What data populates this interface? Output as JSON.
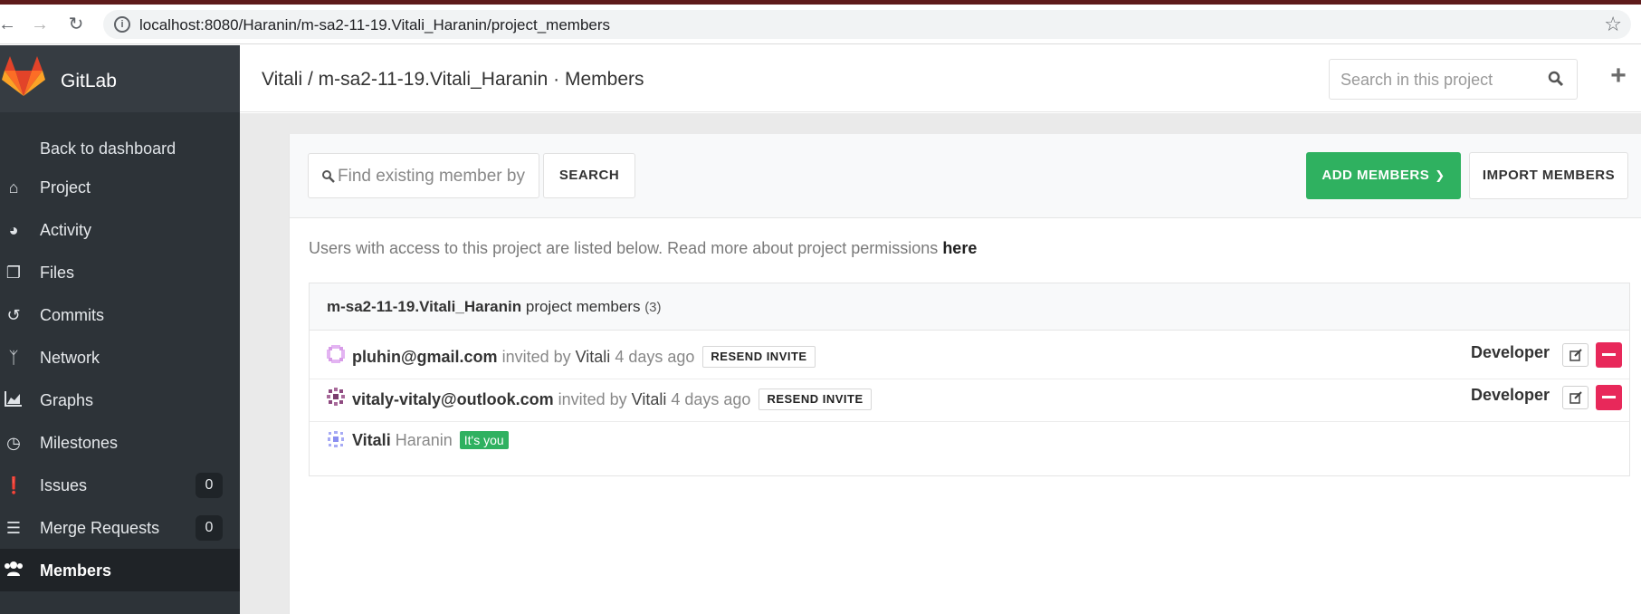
{
  "browser": {
    "url": "localhost:8080/Haranin/m-sa2-11-19.Vitali_Haranin/project_members"
  },
  "sidebar": {
    "brand": "GitLab",
    "back_label": "Back to dashboard",
    "items": [
      {
        "label": "Project",
        "icon": "home-icon"
      },
      {
        "label": "Activity",
        "icon": "dashboard-icon"
      },
      {
        "label": "Files",
        "icon": "files-icon"
      },
      {
        "label": "Commits",
        "icon": "history-icon"
      },
      {
        "label": "Network",
        "icon": "code-fork-icon"
      },
      {
        "label": "Graphs",
        "icon": "area-chart-icon"
      },
      {
        "label": "Milestones",
        "icon": "clock-icon"
      },
      {
        "label": "Issues",
        "icon": "exclamation-circle-icon",
        "badge": "0"
      },
      {
        "label": "Merge Requests",
        "icon": "tasks-icon",
        "badge": "0"
      },
      {
        "label": "Members",
        "icon": "users-icon",
        "active": true
      }
    ]
  },
  "header": {
    "title": "Vitali / m-sa2-11-19.Vitali_Haranin · Members",
    "search_placeholder": "Search in this project"
  },
  "toolbar": {
    "find_placeholder": "Find existing member by",
    "search_label": "SEARCH",
    "add_label": "ADD MEMBERS",
    "import_label": "IMPORT MEMBERS"
  },
  "info": {
    "text": "Users with access to this project are listed below. Read more about project permissions ",
    "link": "here"
  },
  "members": {
    "project_name": "m-sa2-11-19.Vitali_Haranin",
    "heading_suffix": " project members ",
    "count": "(3)",
    "rows": [
      {
        "name": "pluhin@gmail.com",
        "invited_text": " invited by ",
        "by": "Vitali",
        "ago": " 4 days ago",
        "resend": "RESEND INVITE",
        "role": "Developer"
      },
      {
        "name": "vitaly-vitaly@outlook.com",
        "invited_text": " invited by ",
        "by": "Vitali",
        "ago": " 4 days ago",
        "resend": "RESEND INVITE",
        "role": "Developer"
      },
      {
        "name": "Vitali",
        "lastname": " Haranin",
        "badge": "It's you"
      }
    ]
  },
  "colors": {
    "sidebar_bg": "#2d3338",
    "accent_green": "#2fb160",
    "danger_pink": "#e8285a"
  }
}
